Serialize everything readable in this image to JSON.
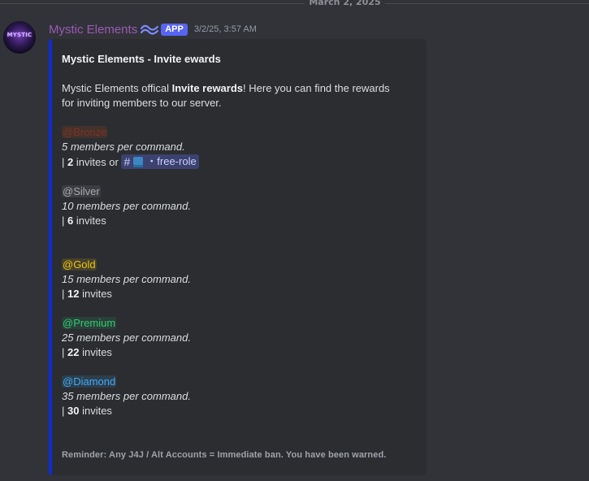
{
  "divider": {
    "date": "March 2, 2025"
  },
  "message": {
    "avatar_text": "MYSTIC",
    "username": "Mystic Elements",
    "badge": "APP",
    "timestamp": "3/2/25, 3:57 AM",
    "embed": {
      "accent_color": "#0b2cd6",
      "title": "Mystic Elements - Invite ewards",
      "description_prefix": "Mystic Elements offical ",
      "description_bold": "Invite rewards",
      "description_suffix": "! Here you can find the rewards",
      "description_line2": "for inviting members to our server.",
      "tiers": [
        {
          "role": "@Bronze",
          "per_command": "5 members per command.",
          "prefix": "| ",
          "invites": "2",
          "invites_label": " invites or ",
          "channel_hash": "#",
          "channel_name": "・free-role"
        },
        {
          "role": "@Silver",
          "per_command": "10 members per command.",
          "prefix": "| ",
          "invites": "6",
          "invites_label": " invites"
        },
        {
          "role": "@Gold",
          "per_command": "15 members per command.",
          "prefix": "| ",
          "invites": "12",
          "invites_label": " invites"
        },
        {
          "role": "@Premium",
          "per_command": "25 members per command.",
          "prefix": "| ",
          "invites": "22",
          "invites_label": " invites"
        },
        {
          "role": "@Diamond",
          "per_command": "35 members per command.",
          "prefix": "| ",
          "invites": "30",
          "invites_label": " invites"
        }
      ],
      "footer": "Reminder: Any J4J / Alt Accounts = Immediate ban. You have been warned."
    }
  },
  "colors": {
    "background": "#323339",
    "embed_background": "#2b2d31",
    "username": "#9b59b6",
    "app_badge": "#5865f2"
  }
}
